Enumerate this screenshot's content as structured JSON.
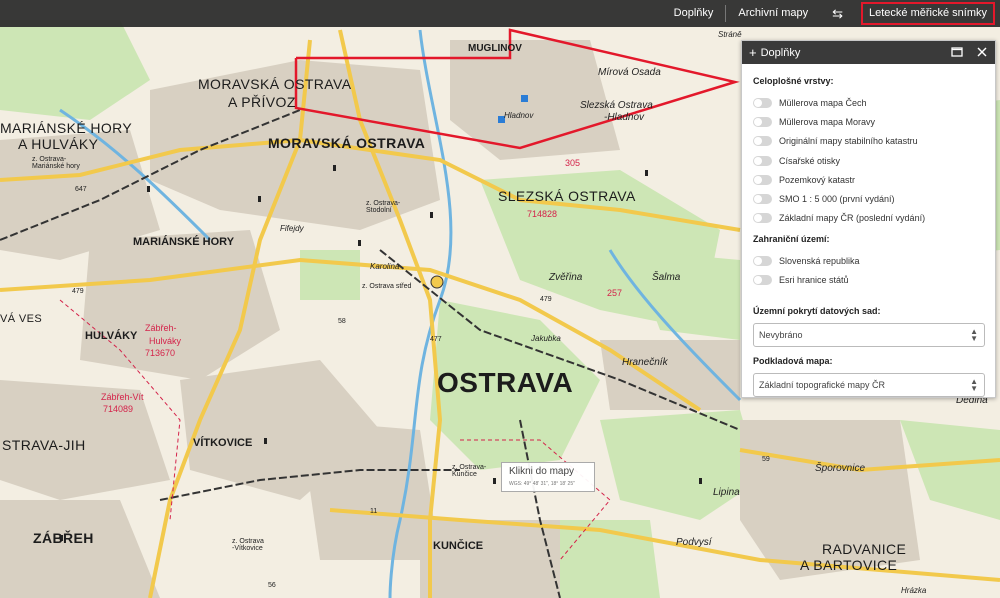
{
  "toolbar": {
    "items": [
      {
        "label": "Doplňky"
      },
      {
        "label": "Archivní mapy"
      },
      {
        "label": "⇆"
      },
      {
        "label": "Letecké měřické snímky"
      }
    ]
  },
  "panel": {
    "title": "Doplňky",
    "section1": "Celoplošné vrstvy:",
    "layers1": [
      "Müllerova mapa Čech",
      "Müllerova mapa Moravy",
      "Originální mapy stabilního katastru",
      "Císařské otisky",
      "Pozemkový katastr",
      "SMO 1 : 5 000 (první vydání)",
      "Základní mapy ČR (poslední vydání)"
    ],
    "section2": "Zahraniční území:",
    "layers2": [
      "Slovenská republika",
      "Esri hranice států"
    ],
    "coverage_label": "Územní pokrytí datových sad:",
    "coverage_value": "Nevybráno",
    "basemap_label": "Podkladová mapa:",
    "basemap_value": "Základní topografické mapy ČR"
  },
  "popup": {
    "text": "Klikni do mapy",
    "coords": "WGS: 49° 48' 31\", 18° 18' 25\""
  },
  "map_labels": {
    "ostrava": "OSTRAVA",
    "moravska_ostrava_privoz_1": "MORAVSKÁ OSTRAVA",
    "moravska_ostrava_privoz_2": "A PŘÍVOZ",
    "moravska_ostrava": "MORAVSKÁ OSTRAVA",
    "slezska_ostrava": "SLEZSKÁ OSTRAVA",
    "marianske_hory_hulvaky_1": "MARIÁNSKÉ HORY",
    "marianske_hory_hulvaky_2": "A HULVÁKY",
    "marianske_hory": "MARIÁNSKÉ HORY",
    "hulvaky": "HULVÁKY",
    "vitkovice": "VÍTKOVICE",
    "ostrava_jih": "STRAVA-JIH",
    "zabreh": "ZÁBŘEH",
    "kuncice": "KUNČICE",
    "radvanice_1": "RADVANICE",
    "radvanice_2": "A BARTOVICE",
    "muglinov": "MUGLINOV",
    "va_ves": "VÁ VES",
    "mirova_osada": "Mírová Osada",
    "slezska_hladnov_1": "Slezská Ostrava",
    "slezska_hladnov_2": "-Hladnov",
    "hladnov": "Hladnov",
    "zverina": "Zvěřina",
    "salma": "Šalma",
    "hranecnik": "Hranečník",
    "jakubka": "Jakubka",
    "karolina": "Karolina",
    "firejdy": "Fifejdy",
    "lipina": "Lipina",
    "sporovnice": "Šporovnice",
    "podvysi": "Podvysí",
    "dedina": "Dědina",
    "hrazka": "Hrázka",
    "strana": "Stráně",
    "code_714828": "714828",
    "code_713670": "713670",
    "code_714089": "714089",
    "zabreh_hulvaky_1": "Zábřeh-",
    "zabreh_hulvaky_2": "Hulváky",
    "zabreh_vit": "Zábřeh-Vít",
    "elev_305": "305",
    "elev_257": "257",
    "road_647": "647",
    "road_479a": "479",
    "road_479b": "479",
    "road_477": "477",
    "road_58": "58",
    "road_59": "59",
    "road_11": "11",
    "road_56": "56",
    "station_marianske": "z. Ostrava-\nMariánské hory",
    "station_stodolni": "z. Ostrava-\nStodolní",
    "station_stred": "z. Ostrava střed",
    "station_kuncice": "z. Ostrava-\nKunčice",
    "station_vitkovice": "z. Ostrava\n-Vítkovice"
  }
}
